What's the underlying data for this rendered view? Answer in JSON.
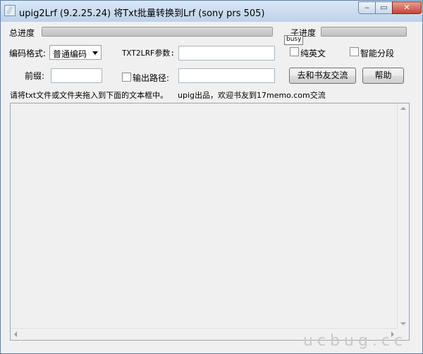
{
  "window": {
    "title": "upig2Lrf (9.2.25.24) 将Txt批量转换到Lrf (sony prs 505)",
    "minimize": "‒",
    "maximize": "▭",
    "close": "✕"
  },
  "progress": {
    "total_label": "总进度",
    "total_value": 0,
    "sub_label": "子进度",
    "sub_value": 0
  },
  "tooltip": "busy",
  "encoding": {
    "label": "编码格式:",
    "selected": "普通编码"
  },
  "param": {
    "label": "TXT2LRF参数:",
    "value": ""
  },
  "options": {
    "pure_english": "纯英文",
    "smart_split": "智能分段",
    "output_path": "输出路径:"
  },
  "prefix": {
    "label": "前缀:",
    "value": ""
  },
  "output_path_value": "",
  "buttons": {
    "community": "去和书友交流",
    "help": "帮助"
  },
  "instructions": {
    "drag_hint": "请将txt文件或文件夹拖入到下面的文本框中。",
    "credit": "upig出品，欢迎书友到17memo.com交流"
  },
  "watermark": "ucbug.cc",
  "colors": {
    "titlebar": "#bcd1ea",
    "close_button": "#c5453a",
    "progress_fill": "#4cc24c"
  }
}
